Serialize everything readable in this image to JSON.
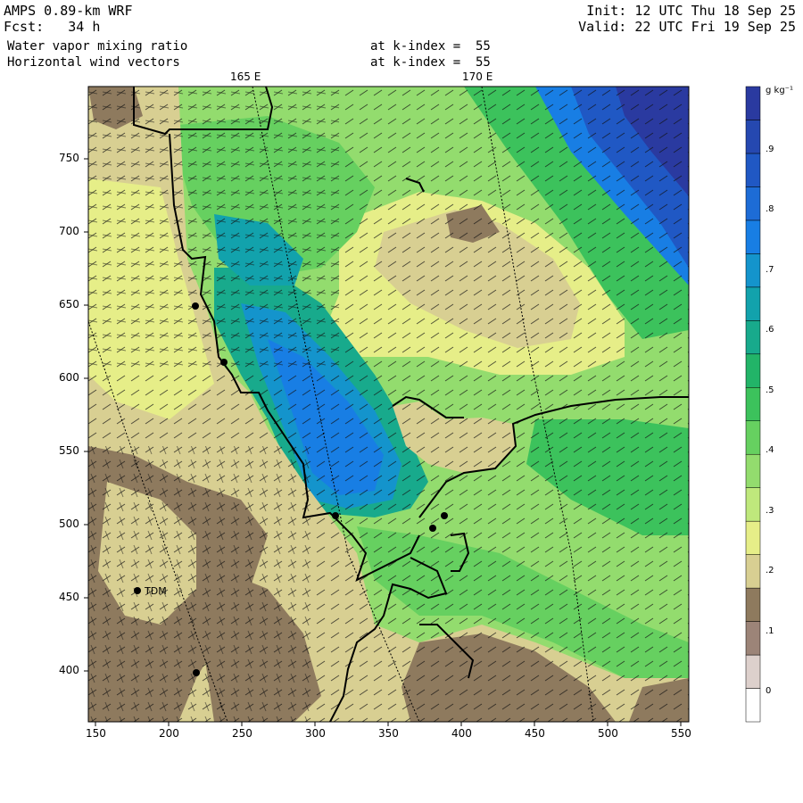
{
  "header": {
    "model": "AMPS 0.89-km WRF",
    "forecast": "Fcst:   34 h",
    "init": "Init: 12 UTC Thu 18 Sep 25",
    "valid": "Valid: 22 UTC Fri 19 Sep 25",
    "field1": "Water vapor mixing ratio",
    "field2": "Horizontal wind vectors",
    "level1": "at k-index =  55",
    "level2": "at k-index =  55"
  },
  "top_labels": [
    "165 E",
    "170 E"
  ],
  "x_ticks": [
    "150",
    "200",
    "250",
    "300",
    "350",
    "400",
    "450",
    "500",
    "550"
  ],
  "y_ticks": [
    "750",
    "700",
    "650",
    "600",
    "550",
    "500",
    "450",
    "400"
  ],
  "station_label": "TDM",
  "colorbar": {
    "unit": "g kg⁻¹",
    "labels": [
      "0",
      ".1",
      ".2",
      ".3",
      ".4",
      ".5",
      ".6",
      ".7",
      ".8",
      ".9"
    ],
    "colors": [
      "#ffffff",
      "#ddd0cc",
      "#9c8478",
      "#8e7a5e",
      "#d8cf92",
      "#e6ee88",
      "#bfe87c",
      "#93dc6e",
      "#66d060",
      "#3cc25c",
      "#22b468",
      "#18aa8c",
      "#12a2ac",
      "#1494cc",
      "#187ee4",
      "#1d6cd6",
      "#2058c4",
      "#2548b0",
      "#2a3aa0"
    ]
  }
}
